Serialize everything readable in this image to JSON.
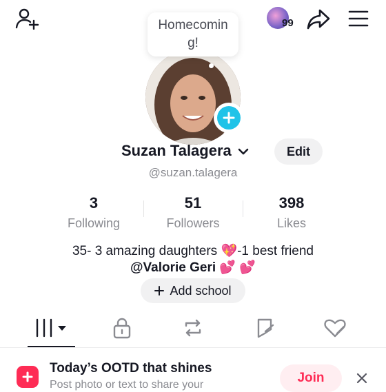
{
  "header": {
    "add_friend_icon": "person-plus-icon",
    "notification_badge": "99",
    "share_icon": "share-arrow-icon",
    "menu_icon": "hamburger-menu-icon"
  },
  "profile": {
    "bubble_text": "Homecoming!",
    "name": "Suzan Talagera",
    "handle": "@suzan.talagera",
    "edit_label": "Edit"
  },
  "stats": [
    {
      "value": "3",
      "label": "Following"
    },
    {
      "value": "51",
      "label": "Followers"
    },
    {
      "value": "398",
      "label": "Likes"
    }
  ],
  "bio": {
    "line1_before": "35- 3 amazing daughters ",
    "line1_emoji": "💖",
    "line1_after": "-1 best friend",
    "line2_mention": "@Valorie Geri ",
    "line2_emoji": "💕 💕"
  },
  "add_school": {
    "label": "Add school"
  },
  "tabs": [
    {
      "name": "videos-grid-icon"
    },
    {
      "name": "lock-icon"
    },
    {
      "name": "repost-icon"
    },
    {
      "name": "favorites-icon"
    },
    {
      "name": "liked-icon"
    }
  ],
  "promo": {
    "title": "Today’s OOTD that shines",
    "subtitle": "Post photo or text to share your",
    "join_label": "Join"
  },
  "colors": {
    "accent": "#fe2c55",
    "plus_badge": "#20c3e8"
  }
}
